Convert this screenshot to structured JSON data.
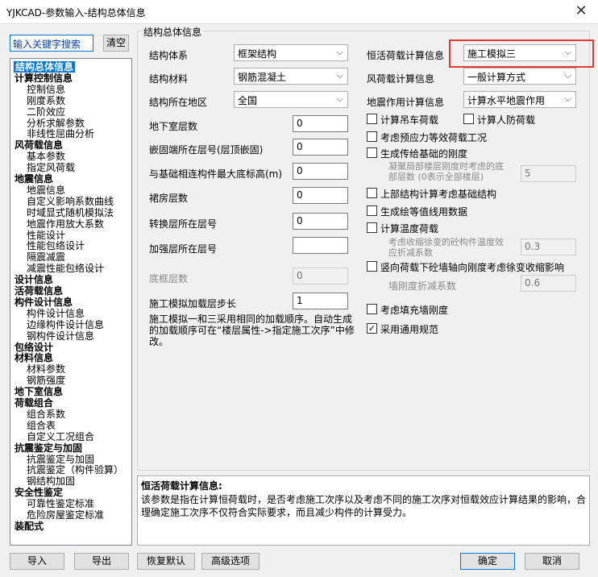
{
  "window": {
    "title": "YJKCAD-参数输入-结构总体信息",
    "close_glyph": "✕"
  },
  "search": {
    "value": "输入关键字搜索",
    "clear_label": "清空"
  },
  "tree": [
    {
      "label": "结构总体信息",
      "level": 0,
      "selected": true
    },
    {
      "label": "计算控制信息",
      "level": 0
    },
    {
      "label": "控制信息",
      "level": 1
    },
    {
      "label": "刚度系数",
      "level": 1
    },
    {
      "label": "二阶效应",
      "level": 1
    },
    {
      "label": "分析求解参数",
      "level": 1
    },
    {
      "label": "非线性屈曲分析",
      "level": 1
    },
    {
      "label": "风荷载信息",
      "level": 0
    },
    {
      "label": "基本参数",
      "level": 1
    },
    {
      "label": "指定风荷载",
      "level": 1
    },
    {
      "label": "地震信息",
      "level": 0
    },
    {
      "label": "地震信息",
      "level": 1
    },
    {
      "label": "自定义影响系数曲线",
      "level": 1
    },
    {
      "label": "时域显式随机模拟法",
      "level": 1
    },
    {
      "label": "地震作用放大系数",
      "level": 1
    },
    {
      "label": "性能设计",
      "level": 1
    },
    {
      "label": "性能包络设计",
      "level": 1
    },
    {
      "label": "隔震减震",
      "level": 1
    },
    {
      "label": "减震性能包络设计",
      "level": 1
    },
    {
      "label": "设计信息",
      "level": 0
    },
    {
      "label": "活荷载信息",
      "level": 0
    },
    {
      "label": "构件设计信息",
      "level": 0
    },
    {
      "label": "构件设计信息",
      "level": 1
    },
    {
      "label": "边缘构件设计信息",
      "level": 1
    },
    {
      "label": "钢构件设计信息",
      "level": 1
    },
    {
      "label": "包络设计",
      "level": 0
    },
    {
      "label": "材料信息",
      "level": 0
    },
    {
      "label": "材料参数",
      "level": 1
    },
    {
      "label": "钢筋强度",
      "level": 1
    },
    {
      "label": "地下室信息",
      "level": 0
    },
    {
      "label": "荷载组合",
      "level": 0
    },
    {
      "label": "组合系数",
      "level": 1
    },
    {
      "label": "组合表",
      "level": 1
    },
    {
      "label": "自定义工况组合",
      "level": 1
    },
    {
      "label": "抗震鉴定与加固",
      "level": 0
    },
    {
      "label": "抗震鉴定与加固",
      "level": 1
    },
    {
      "label": "抗震鉴定（构件验算）",
      "level": 1
    },
    {
      "label": "钢结构加固",
      "level": 1
    },
    {
      "label": "安全性鉴定",
      "level": 0
    },
    {
      "label": "可靠性鉴定标准",
      "level": 1
    },
    {
      "label": "危险房屋鉴定标准",
      "level": 1
    },
    {
      "label": "装配式",
      "level": 0
    }
  ],
  "group_title": "结构总体信息",
  "left_form": {
    "structure_system": {
      "label": "结构体系",
      "value": "框架结构"
    },
    "structure_material": {
      "label": "结构材料",
      "value": "钢筋混凝土"
    },
    "region": {
      "label": "结构所在地区",
      "value": "全国"
    },
    "basement_floors": {
      "label": "地下室层数",
      "value": "0"
    },
    "embed_floor": {
      "label": "嵌固端所在层号(层顶嵌固)",
      "value": "0"
    },
    "base_elevation": {
      "label": "与基础相连构件最大底标高(m)",
      "value": "0"
    },
    "podium_floors": {
      "label": "裙房层数",
      "value": "0"
    },
    "transfer_floor": {
      "label": "转换层所在层号",
      "value": "0"
    },
    "strengthen_floor": {
      "label": "加强层所在层号",
      "value": ""
    },
    "base_frame_floors": {
      "label": "底框层数",
      "value": "0"
    },
    "load_step": {
      "label": "施工模拟加载层步长",
      "value": "1"
    },
    "note": "施工模拟一和三采用相同的加载顺序。自动生成的加载顺序可在“楼层属性->指定施工次序”中修改。"
  },
  "right_form": {
    "dead_live_calc": {
      "label": "恒活荷载计算信息",
      "value": "施工模拟三"
    },
    "wind_calc": {
      "label": "风荷载计算信息",
      "value": "一般计算方式"
    },
    "seismic_calc": {
      "label": "地震作用计算信息",
      "value": "计算水平地震作用"
    },
    "crane_load": {
      "label": "计算吊车荷载",
      "checked": false
    },
    "civil_defense_load": {
      "label": "计算人防荷载",
      "checked": false
    },
    "prestress": {
      "label": "考虑预应力等效荷载工况",
      "checked": false
    },
    "foundation_stiffness": {
      "label": "生成传给基础的刚度",
      "checked": false
    },
    "condensed_floors": {
      "label": "凝聚局部楼层刚度时考虑的底部层数 (0表示全部楼层)",
      "value": "5"
    },
    "consider_foundation": {
      "label": "上部结构计算考虑基础结构",
      "checked": false
    },
    "contour_data": {
      "label": "生成绘等值线用数据",
      "checked": false
    },
    "temperature_load": {
      "label": "计算温度荷载",
      "checked": false
    },
    "creep_factor": {
      "label": "考虑收缩徐变的砼构件温度效应折减系数",
      "value": "0.3"
    },
    "vertical_creep": {
      "label": "竖向荷载下砼墙轴向刚度考虑徐变收缩影响",
      "checked": false
    },
    "wall_stiffness_factor": {
      "label": "墙刚度折减系数",
      "value": "0.6"
    },
    "infill_wall": {
      "label": "考虑填充墙刚度",
      "checked": false
    },
    "general_code": {
      "label": "采用通用规范",
      "checked": true
    }
  },
  "description": {
    "title": "恒活荷载计算信息:",
    "text": "该参数是指在计算恒荷载时，是否考虑施工次序以及考虑不同的施工次序对恒载效应计算结果的影响，合理确定施工次序不仅符合实际要求，而且减少构件的计算受力。"
  },
  "buttons": {
    "import": "导入",
    "export": "导出",
    "restore": "恢复默认",
    "advanced": "高级选项",
    "ok": "确定",
    "cancel": "取消"
  },
  "icons": {
    "dropdown": "chevron-down-icon",
    "check": "checkmark-icon"
  },
  "colors": {
    "selection": "#0078d7",
    "highlight_border": "#e53935"
  }
}
